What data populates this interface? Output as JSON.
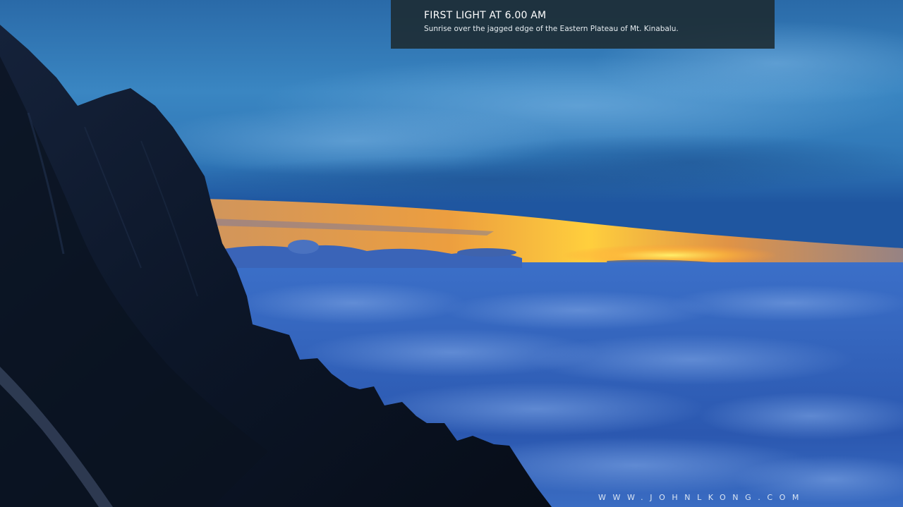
{
  "caption": {
    "title": "FIRST LIGHT AT 6.00 AM",
    "subtitle": "Sunrise over the jagged edge of the Eastern Plateau of Mt. Kinabalu."
  },
  "watermark": {
    "text": "WWW.JOHNLKONG.COM"
  },
  "colors": {
    "sky_top": "#2f73b0",
    "sky_mid": "#3a86c4",
    "sunrise_orange": "#f29a3a",
    "sunrise_yellow": "#ffd34a",
    "cloud_sea": "#2d5fb8",
    "mountain": "#0b1424",
    "caption_bg": "#1c2a30"
  }
}
